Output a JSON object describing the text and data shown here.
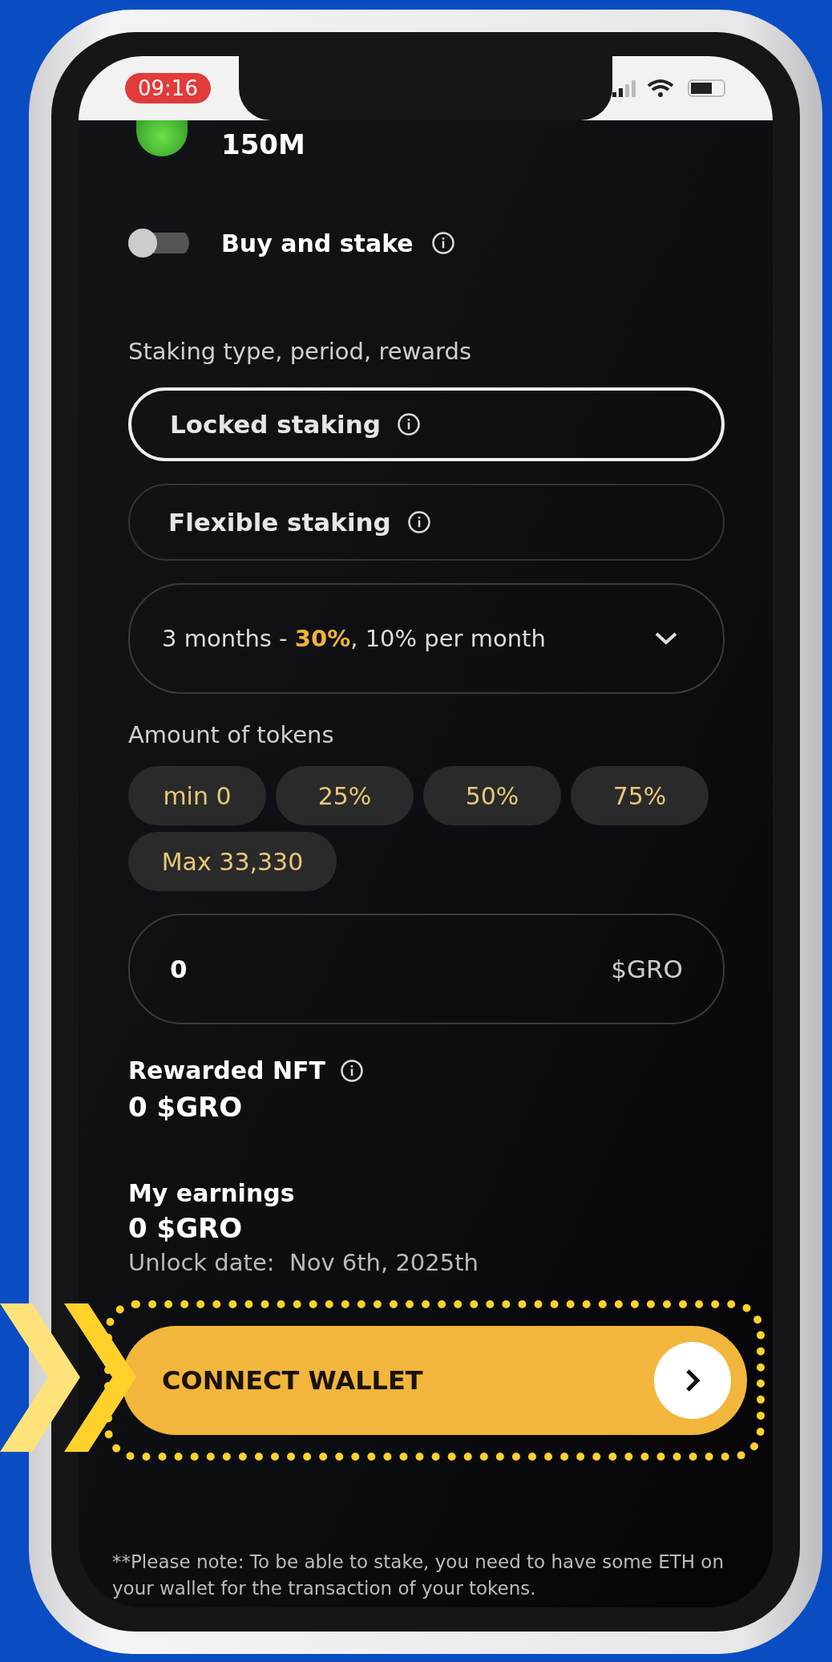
{
  "status_bar": {
    "time": "09:16"
  },
  "balance": {
    "amount": "150M"
  },
  "buy_and_stake": {
    "label": "Buy and stake",
    "on": false
  },
  "staking": {
    "label": "Staking type, period, rewards",
    "options": [
      {
        "label": "Locked staking",
        "selected": true
      },
      {
        "label": "Flexible staking",
        "selected": false
      }
    ],
    "period": "3 months - **30%**, 10% per month"
  },
  "amount": {
    "label": "Amount of tokens",
    "chips": [
      "min 0",
      "25%",
      "50%",
      "75%",
      "Max 33,330"
    ],
    "input": {
      "value": "0",
      "unit": "$GRO"
    }
  },
  "rewarded_nft": {
    "label": "Rewarded NFT",
    "value": "0 $GRO"
  },
  "earnings": {
    "label": "My earnings",
    "value": "0 $GRO",
    "unlock_label": "Unlock date:",
    "unlock_date": "Nov 6th, 2025th"
  },
  "connect_button": {
    "label": "CONNECT WALLET",
    "highlighted": true
  },
  "note": "**Please note: To be able to stake, you need to have some ETH on your wallet for the transaction of your tokens."
}
